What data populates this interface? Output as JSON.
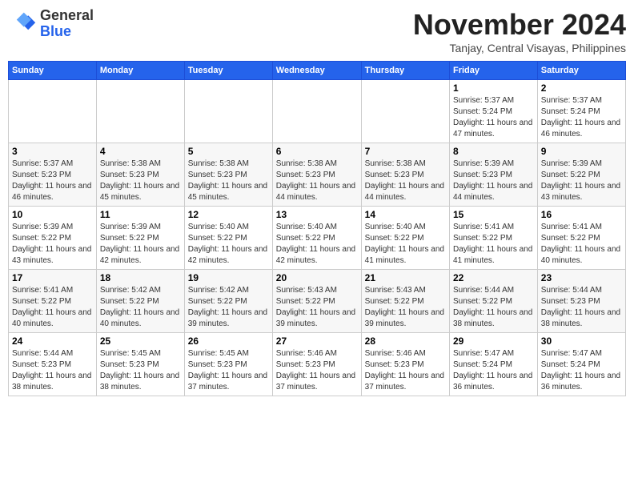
{
  "header": {
    "logo_general": "General",
    "logo_blue": "Blue",
    "month_title": "November 2024",
    "location": "Tanjay, Central Visayas, Philippines"
  },
  "days_of_week": [
    "Sunday",
    "Monday",
    "Tuesday",
    "Wednesday",
    "Thursday",
    "Friday",
    "Saturday"
  ],
  "weeks": [
    [
      {
        "day": "",
        "info": ""
      },
      {
        "day": "",
        "info": ""
      },
      {
        "day": "",
        "info": ""
      },
      {
        "day": "",
        "info": ""
      },
      {
        "day": "",
        "info": ""
      },
      {
        "day": "1",
        "info": "Sunrise: 5:37 AM\nSunset: 5:24 PM\nDaylight: 11 hours and 47 minutes."
      },
      {
        "day": "2",
        "info": "Sunrise: 5:37 AM\nSunset: 5:24 PM\nDaylight: 11 hours and 46 minutes."
      }
    ],
    [
      {
        "day": "3",
        "info": "Sunrise: 5:37 AM\nSunset: 5:23 PM\nDaylight: 11 hours and 46 minutes."
      },
      {
        "day": "4",
        "info": "Sunrise: 5:38 AM\nSunset: 5:23 PM\nDaylight: 11 hours and 45 minutes."
      },
      {
        "day": "5",
        "info": "Sunrise: 5:38 AM\nSunset: 5:23 PM\nDaylight: 11 hours and 45 minutes."
      },
      {
        "day": "6",
        "info": "Sunrise: 5:38 AM\nSunset: 5:23 PM\nDaylight: 11 hours and 44 minutes."
      },
      {
        "day": "7",
        "info": "Sunrise: 5:38 AM\nSunset: 5:23 PM\nDaylight: 11 hours and 44 minutes."
      },
      {
        "day": "8",
        "info": "Sunrise: 5:39 AM\nSunset: 5:23 PM\nDaylight: 11 hours and 44 minutes."
      },
      {
        "day": "9",
        "info": "Sunrise: 5:39 AM\nSunset: 5:22 PM\nDaylight: 11 hours and 43 minutes."
      }
    ],
    [
      {
        "day": "10",
        "info": "Sunrise: 5:39 AM\nSunset: 5:22 PM\nDaylight: 11 hours and 43 minutes."
      },
      {
        "day": "11",
        "info": "Sunrise: 5:39 AM\nSunset: 5:22 PM\nDaylight: 11 hours and 42 minutes."
      },
      {
        "day": "12",
        "info": "Sunrise: 5:40 AM\nSunset: 5:22 PM\nDaylight: 11 hours and 42 minutes."
      },
      {
        "day": "13",
        "info": "Sunrise: 5:40 AM\nSunset: 5:22 PM\nDaylight: 11 hours and 42 minutes."
      },
      {
        "day": "14",
        "info": "Sunrise: 5:40 AM\nSunset: 5:22 PM\nDaylight: 11 hours and 41 minutes."
      },
      {
        "day": "15",
        "info": "Sunrise: 5:41 AM\nSunset: 5:22 PM\nDaylight: 11 hours and 41 minutes."
      },
      {
        "day": "16",
        "info": "Sunrise: 5:41 AM\nSunset: 5:22 PM\nDaylight: 11 hours and 40 minutes."
      }
    ],
    [
      {
        "day": "17",
        "info": "Sunrise: 5:41 AM\nSunset: 5:22 PM\nDaylight: 11 hours and 40 minutes."
      },
      {
        "day": "18",
        "info": "Sunrise: 5:42 AM\nSunset: 5:22 PM\nDaylight: 11 hours and 40 minutes."
      },
      {
        "day": "19",
        "info": "Sunrise: 5:42 AM\nSunset: 5:22 PM\nDaylight: 11 hours and 39 minutes."
      },
      {
        "day": "20",
        "info": "Sunrise: 5:43 AM\nSunset: 5:22 PM\nDaylight: 11 hours and 39 minutes."
      },
      {
        "day": "21",
        "info": "Sunrise: 5:43 AM\nSunset: 5:22 PM\nDaylight: 11 hours and 39 minutes."
      },
      {
        "day": "22",
        "info": "Sunrise: 5:44 AM\nSunset: 5:22 PM\nDaylight: 11 hours and 38 minutes."
      },
      {
        "day": "23",
        "info": "Sunrise: 5:44 AM\nSunset: 5:23 PM\nDaylight: 11 hours and 38 minutes."
      }
    ],
    [
      {
        "day": "24",
        "info": "Sunrise: 5:44 AM\nSunset: 5:23 PM\nDaylight: 11 hours and 38 minutes."
      },
      {
        "day": "25",
        "info": "Sunrise: 5:45 AM\nSunset: 5:23 PM\nDaylight: 11 hours and 38 minutes."
      },
      {
        "day": "26",
        "info": "Sunrise: 5:45 AM\nSunset: 5:23 PM\nDaylight: 11 hours and 37 minutes."
      },
      {
        "day": "27",
        "info": "Sunrise: 5:46 AM\nSunset: 5:23 PM\nDaylight: 11 hours and 37 minutes."
      },
      {
        "day": "28",
        "info": "Sunrise: 5:46 AM\nSunset: 5:23 PM\nDaylight: 11 hours and 37 minutes."
      },
      {
        "day": "29",
        "info": "Sunrise: 5:47 AM\nSunset: 5:24 PM\nDaylight: 11 hours and 36 minutes."
      },
      {
        "day": "30",
        "info": "Sunrise: 5:47 AM\nSunset: 5:24 PM\nDaylight: 11 hours and 36 minutes."
      }
    ]
  ]
}
